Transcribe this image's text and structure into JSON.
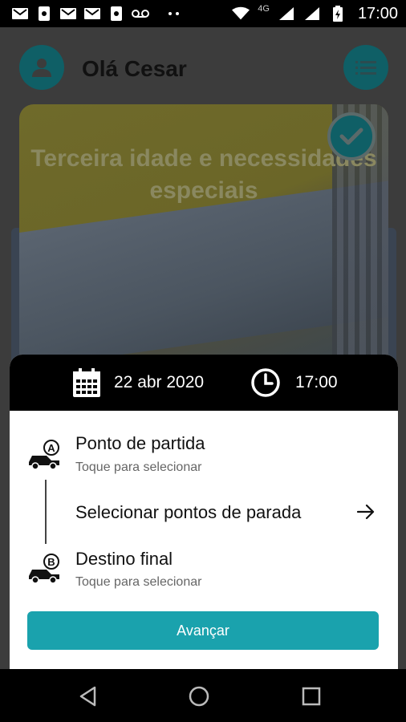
{
  "status_bar": {
    "time": "17:00",
    "network": "4G",
    "icons": [
      "gmail-icon",
      "phone-sync-icon",
      "gmail-icon",
      "gmail-icon",
      "phone-sync-icon",
      "voicemail-icon",
      "more-icon",
      "wifi-icon",
      "signal-icon",
      "signal-icon",
      "battery-icon"
    ]
  },
  "header": {
    "greeting": "Olá Cesar"
  },
  "card": {
    "title": "Terceira idade e necessidades especiais",
    "selected": true
  },
  "sheet": {
    "date": "22 abr 2020",
    "time": "17:00",
    "origin": {
      "title": "Ponto de partida",
      "subtitle": "Toque para selecionar",
      "badge": "A"
    },
    "stops_label": "Selecionar pontos de parada",
    "destination": {
      "title": "Destino final",
      "subtitle": "Toque para selecionar",
      "badge": "B"
    },
    "button_label": "Avançar"
  },
  "colors": {
    "accent": "#1aa2ad",
    "dark_teal": "#0f5f66",
    "overlay_dark": "#3c3c3c"
  }
}
